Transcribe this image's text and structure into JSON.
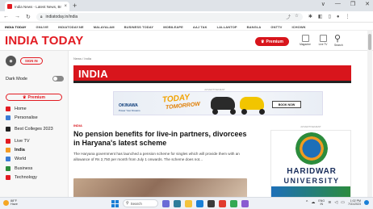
{
  "browser": {
    "tab_title": "India News - Latest News, Breaki",
    "tab_close": "×",
    "new_tab": "+",
    "url": "indiatoday.in/india",
    "window_controls": [
      "∨",
      "—",
      "❐",
      "✕"
    ]
  },
  "site_nav": {
    "items": [
      "INDIA TODAY",
      "GNLIVE",
      "INDIATODAY.NE",
      "MALAYALAM",
      "BUSINESS TODAY",
      "MOBILEAPE",
      "AAJ TAK",
      "LALLANTOP",
      "BANGLA",
      "GNTTV",
      "ICHOWK"
    ]
  },
  "masthead": {
    "logo": "INDIA TODAY",
    "premium": "Premium",
    "magazine": "Magazine",
    "live_tv": "Live TV",
    "search": "Search"
  },
  "sidebar": {
    "sign_in": "SIGN IN",
    "dark_mode": "Dark Mode",
    "premium": "Premium",
    "items": [
      {
        "label": "Home",
        "icon": "home-icon",
        "color": "#e21b22"
      },
      {
        "label": "Personalise",
        "icon": "personalise-icon",
        "color": "#3a7bd5"
      },
      {
        "label": "Best Colleges 2023",
        "icon": "graduation-cap-icon",
        "color": "#222222"
      },
      {
        "label": "Live TV",
        "icon": "live-tv-icon",
        "color": "#e21b22"
      },
      {
        "label": "India",
        "icon": "india-icon",
        "color": "#f59b23"
      },
      {
        "label": "World",
        "icon": "world-icon",
        "color": "#3a7bd5"
      },
      {
        "label": "Business",
        "icon": "business-icon",
        "color": "#2c8c3c"
      },
      {
        "label": "Technology",
        "icon": "technology-icon",
        "color": "#e21b22"
      }
    ]
  },
  "main": {
    "breadcrumb": "News / India",
    "section_title": "INDIA",
    "advertisement": "ADVERTISEMENT",
    "ad": {
      "brand": "OKINAWA",
      "tagline": "Power Your Dreams",
      "headline_1": "TODAY",
      "headline_2": "TOMORROW",
      "cta": "BOOK NOW"
    },
    "article": {
      "kicker": "INDIA",
      "title": "No pension benefits for live-in partners, divorcees in Haryana's latest scheme",
      "summary": "The Haryana government has launched a pension scheme for singles which will provide them with an allowance of Rs 2,750 per month from July 1 onwards. The scheme does not..."
    },
    "right_ad": {
      "label": "ADVERTISEMENT",
      "line1": "HARIDWAR",
      "line2": "UNIVERSITY"
    }
  },
  "taskbar": {
    "weather_temp": "88°F",
    "weather_desc": "Haze",
    "search": "Search",
    "lang_1": "ENG",
    "lang_2": "IN",
    "time": "1:02 PM",
    "date": "7/31/2023"
  }
}
